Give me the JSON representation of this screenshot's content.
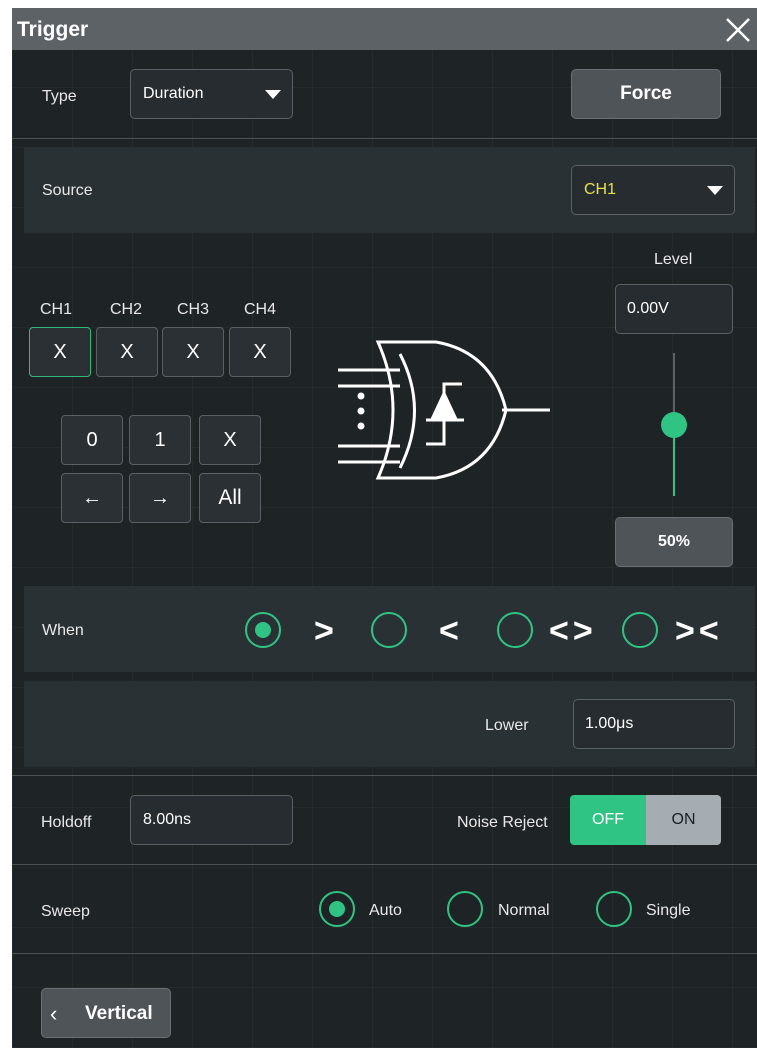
{
  "window": {
    "title": "Trigger",
    "close_icon": "close-icon"
  },
  "type_row": {
    "label": "Type",
    "value": "Duration",
    "force_label": "Force"
  },
  "source_row": {
    "label": "Source",
    "value": "CH1",
    "value_color": "#e5e04a"
  },
  "channels": {
    "headers": [
      "CH1",
      "CH2",
      "CH3",
      "CH4"
    ],
    "values": [
      "X",
      "X",
      "X",
      "X"
    ],
    "selected_index": 0
  },
  "keypad": {
    "row1": [
      "0",
      "1",
      "X"
    ],
    "left_arrow": "←",
    "right_arrow": "→",
    "all_label": "All"
  },
  "level": {
    "label": "Level",
    "value": "0.00V",
    "percent_label": "50%",
    "slider_fraction": 0.5
  },
  "when_row": {
    "label": "When",
    "options": [
      ">",
      "<",
      "<>",
      "><"
    ],
    "selected_index": 0
  },
  "lower_row": {
    "label": "Lower",
    "value": "1.00μs"
  },
  "holdoff_row": {
    "label": "Holdoff",
    "value": "8.00ns",
    "noise_reject_label": "Noise Reject",
    "off_label": "OFF",
    "on_label": "ON",
    "noise_reject_state": "OFF"
  },
  "sweep_row": {
    "label": "Sweep",
    "options": [
      "Auto",
      "Normal",
      "Single"
    ],
    "selected_index": 0
  },
  "footer": {
    "vertical_label": "Vertical",
    "back_chevron": "‹"
  },
  "colors": {
    "accent": "#2fc483",
    "panel": "#1e2326",
    "titlebar": "#5c6266"
  }
}
